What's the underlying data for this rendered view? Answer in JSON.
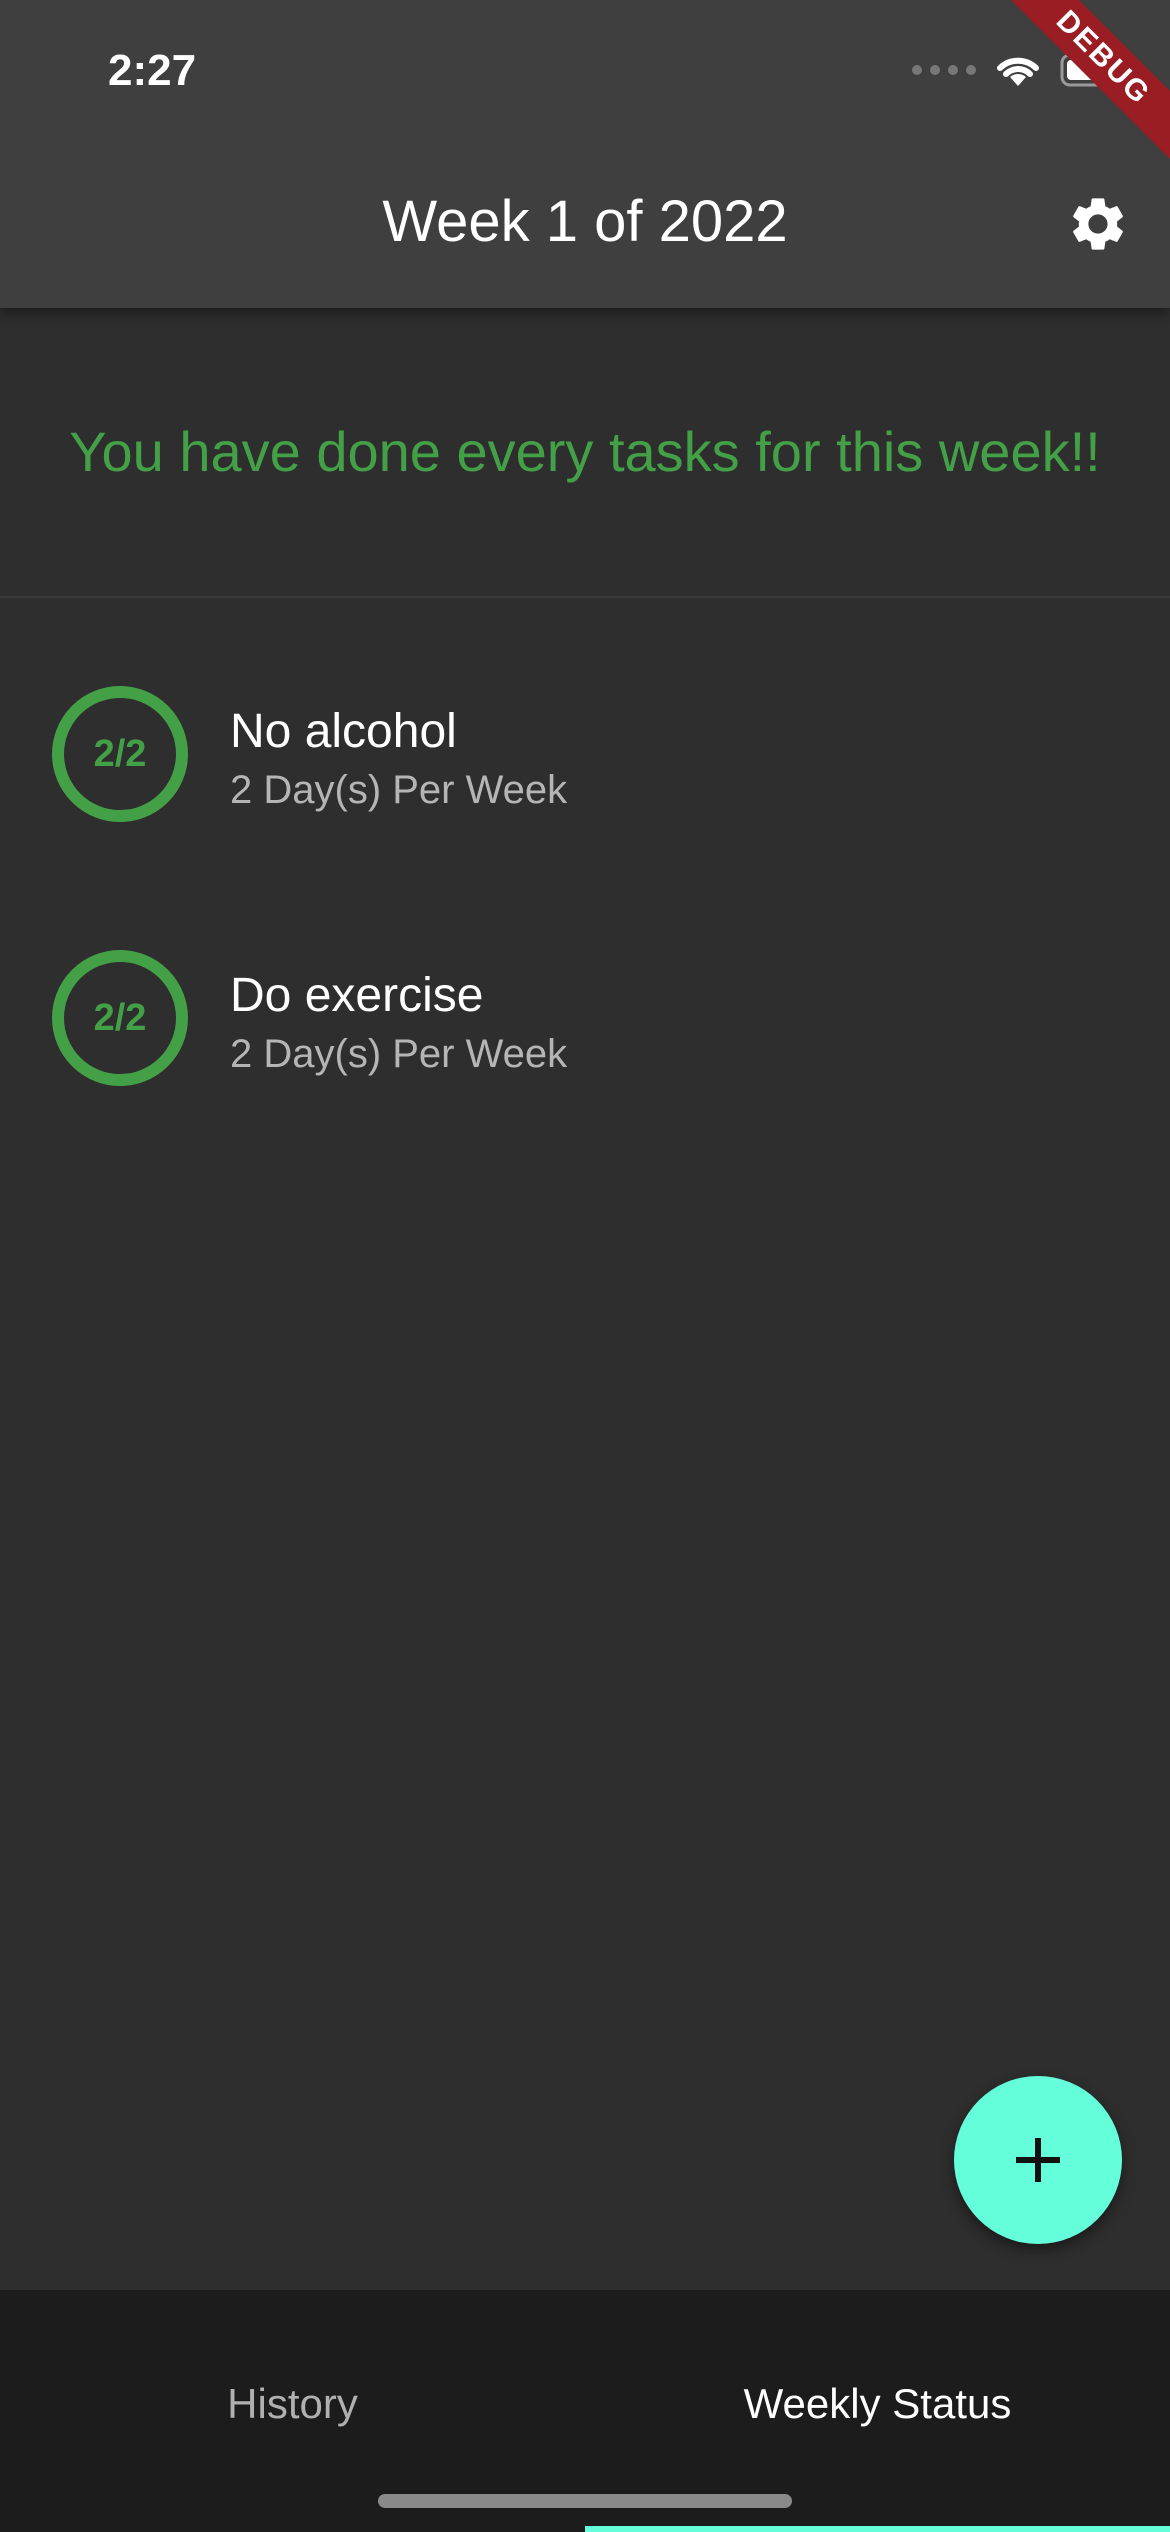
{
  "status_bar": {
    "time": "2:27"
  },
  "debug_banner": "DEBUG",
  "app_bar": {
    "title": "Week 1 of 2022",
    "settings_icon": "gear-icon"
  },
  "banner": {
    "message": "You have done every tasks for this week!!",
    "color": "#43a047"
  },
  "tasks": [
    {
      "progress": "2/2",
      "title": "No alcohol",
      "subtitle": "2 Day(s) Per Week"
    },
    {
      "progress": "2/2",
      "title": "Do exercise",
      "subtitle": "2 Day(s) Per Week"
    }
  ],
  "fab": {
    "icon": "plus-icon",
    "color": "#64ffda"
  },
  "bottom_nav": {
    "tabs": [
      {
        "label": "History",
        "selected": false
      },
      {
        "label": "Weekly Status",
        "selected": true
      }
    ],
    "accent": "#64ffda"
  }
}
